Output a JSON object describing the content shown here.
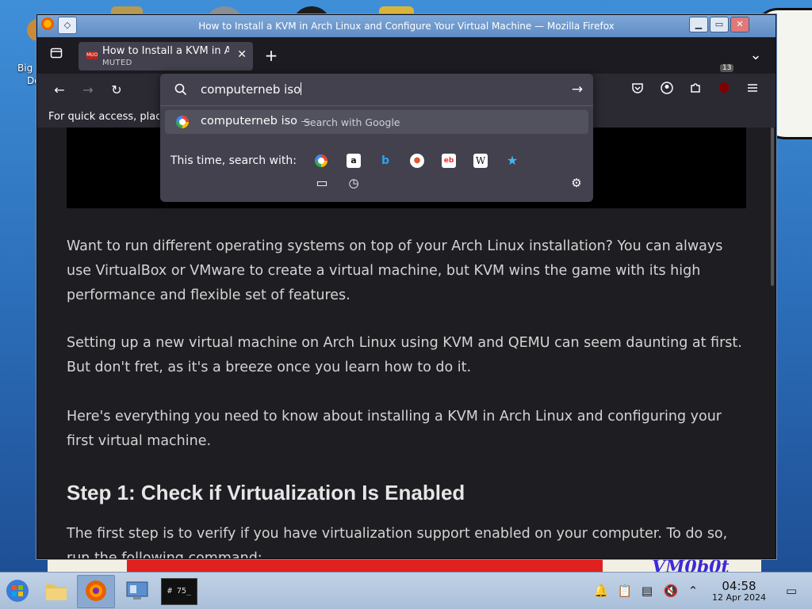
{
  "desktop": {
    "icon_label_line1": "Big",
    "icon_label_line2": "De",
    "watermark_text": "VM0b0t"
  },
  "window": {
    "title": "How to Install a KVM in Arch Linux and Configure Your Virtual Machine — Mozilla Firefox",
    "minimize_glyph": "▁",
    "maximize_glyph": "▭",
    "close_glyph": "✕"
  },
  "tabs": [
    {
      "label": "How to Install a KVM in Arch Linux and Configure Your Virtual Machine",
      "sublabel": "MUTED",
      "favicon_text": "MUO"
    }
  ],
  "toolbar": {
    "new_tab_glyph": "+",
    "list_all_tabs_glyph": "⌄",
    "back_glyph": "←",
    "forward_glyph": "→",
    "reload_glyph": "↻",
    "extensions_badge": "13"
  },
  "bookmarks_bar": {
    "text": "For quick access, place your bookmarks here on the bookmarks toolbar."
  },
  "urlbar": {
    "value": "computerneb iso",
    "go_glyph": "→",
    "suggestion": {
      "query": "computerneb iso",
      "separator": "—",
      "hint": "Search with Google"
    },
    "search_with_label": "This time, search with:",
    "engines": [
      {
        "name": "google",
        "glyph": "G"
      },
      {
        "name": "amazon",
        "glyph": "a"
      },
      {
        "name": "bing",
        "glyph": "b"
      },
      {
        "name": "duckduckgo",
        "glyph": "●"
      },
      {
        "name": "ebay",
        "glyph": "eb"
      },
      {
        "name": "wikipedia",
        "glyph": "W"
      },
      {
        "name": "bookmarks",
        "glyph": "★"
      },
      {
        "name": "tabs",
        "glyph": "▭"
      },
      {
        "name": "history",
        "glyph": "◷"
      }
    ]
  },
  "article": {
    "p1": "Want to run different operating systems on top of your Arch Linux installation? You can always use VirtualBox or VMware to create a virtual machine, but KVM wins the game with its high performance and flexible set of features.",
    "p2": "Setting up a new virtual machine on Arch Linux using KVM and QEMU can seem daunting at first. But don't fret, as it's a breeze once you learn how to do it.",
    "p3": "Here's everything you need to know about installing a KVM in Arch Linux and configuring your first virtual machine.",
    "h2": "Step 1: Check if Virtualization Is Enabled",
    "p4": "The first step is to verify if you have virtualization support enabled on your computer. To do so, run the following command:"
  },
  "taskbar": {
    "clock_time": "04:58",
    "clock_date": "12 Apr 2024",
    "terminal_text": "# 75_"
  }
}
